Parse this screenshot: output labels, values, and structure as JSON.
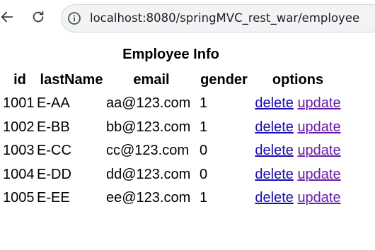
{
  "browser": {
    "url": "localhost:8080/springMVC_rest_war/employee"
  },
  "page": {
    "caption": "Employee Info",
    "headers": {
      "id": "id",
      "lastName": "lastName",
      "email": "email",
      "gender": "gender",
      "options": "options"
    },
    "rows": [
      {
        "id": "1001",
        "lastName": "E-AA",
        "email": "aa@123.com",
        "gender": "1",
        "delete": "delete",
        "update": "update"
      },
      {
        "id": "1002",
        "lastName": "E-BB",
        "email": "bb@123.com",
        "gender": "1",
        "delete": "delete",
        "update": "update"
      },
      {
        "id": "1003",
        "lastName": "E-CC",
        "email": "cc@123.com",
        "gender": "0",
        "delete": "delete",
        "update": "update"
      },
      {
        "id": "1004",
        "lastName": "E-DD",
        "email": "dd@123.com",
        "gender": "0",
        "delete": "delete",
        "update": "update"
      },
      {
        "id": "1005",
        "lastName": "E-EE",
        "email": "ee@123.com",
        "gender": "1",
        "delete": "delete",
        "update": "update"
      }
    ]
  },
  "colors": {
    "link": "#1a0dab",
    "visited_link": "#681da8"
  },
  "icons": {
    "back": "back-arrow-icon",
    "reload": "reload-icon",
    "site_info": "info-icon"
  }
}
